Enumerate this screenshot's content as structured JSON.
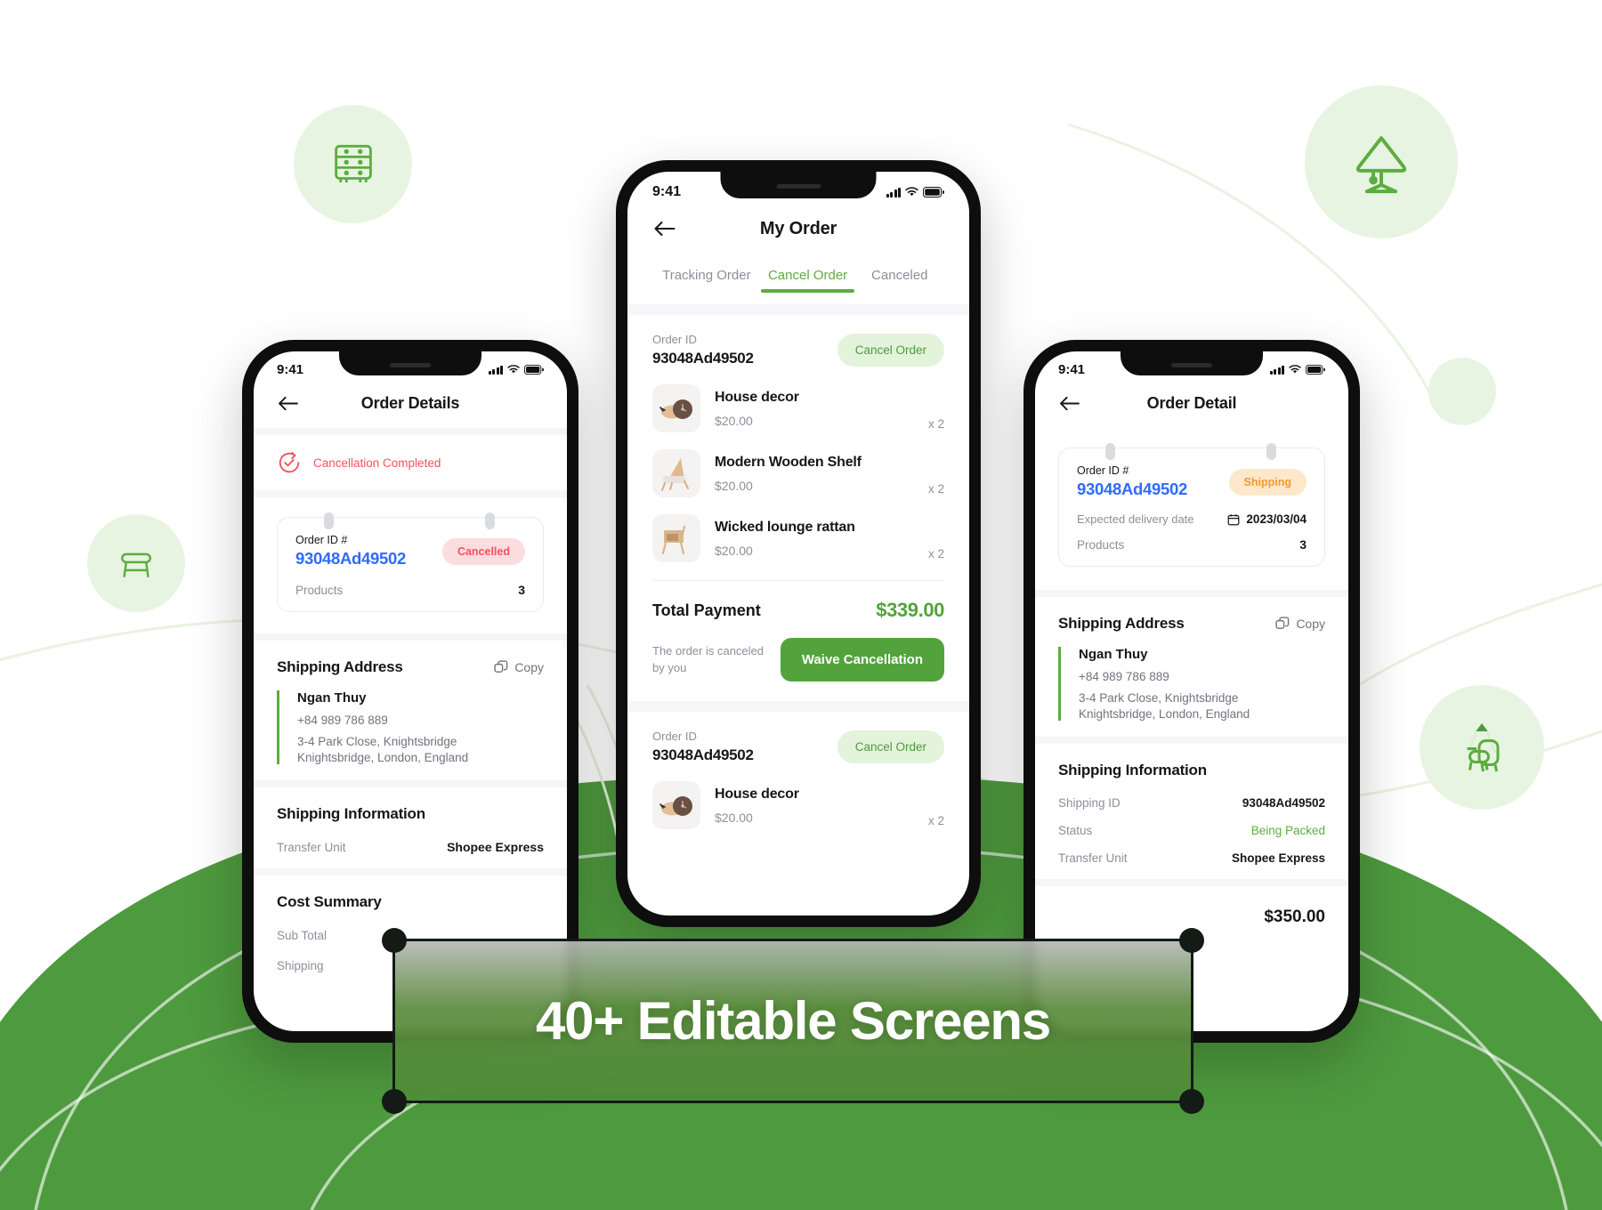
{
  "canvas": {
    "banner_text": "40+ Editable Screens",
    "accent_green": "#5CAD3F",
    "hill_green": "#4E9A3E",
    "blue": "#2F6BFF",
    "red": "#F4525C",
    "orange": "#F59A2B"
  },
  "decor": [
    {
      "name": "dresser-icon",
      "label": "dresser"
    },
    {
      "name": "table-lamp-icon",
      "label": "table lamp"
    },
    {
      "name": "stool-icon",
      "label": "stool"
    },
    {
      "name": "armchair-lamp-icon",
      "label": "armchair with pendant lamp"
    }
  ],
  "phone_left": {
    "status": {
      "time": "9:41",
      "signal": "signal-icon",
      "wifi": "wifi-icon",
      "battery": "battery-icon"
    },
    "nav": {
      "back": "back-arrow-icon",
      "title": "Order Details"
    },
    "alert": {
      "icon": "check-circle-icon",
      "text": "Cancellation Completed"
    },
    "order_card": {
      "id_label": "Order ID #",
      "id_value": "93048Ad49502",
      "badge": "Cancelled",
      "rows": [
        {
          "label": "Products",
          "value": "3"
        }
      ]
    },
    "shipping_address": {
      "title": "Shipping Address",
      "copy_label": "Copy",
      "copy_icon": "copy-icon",
      "name": "Ngan Thuy",
      "phone": "+84 989 786 889",
      "line1": "3-4 Park Close, Knightsbridge",
      "line2": "Knightsbridge, London, England"
    },
    "shipping_information": {
      "title": "Shipping Information",
      "rows": [
        {
          "label": "Transfer Unit",
          "value": "Shopee Express"
        }
      ]
    },
    "cost_summary": {
      "title": "Cost Summary",
      "rows": [
        {
          "label": "Sub Total"
        },
        {
          "label": "Shipping"
        }
      ]
    }
  },
  "phone_center": {
    "status": {
      "time": "9:41",
      "signal": "signal-icon",
      "wifi": "wifi-icon",
      "battery": "battery-icon"
    },
    "nav": {
      "back": "back-arrow-icon",
      "title": "My Order"
    },
    "tabs": [
      {
        "label": "Tracking Order",
        "active": false
      },
      {
        "label": "Cancel Order",
        "active": true
      },
      {
        "label": "Canceled",
        "active": false
      }
    ],
    "order_1": {
      "id_label": "Order ID",
      "id_value": "93048Ad49502",
      "action_label": "Cancel Order",
      "products": [
        {
          "name": "House decor",
          "price": "$20.00",
          "qty": "x 2",
          "thumb": "house-decor-thumb"
        },
        {
          "name": "Modern Wooden Shelf",
          "price": "$20.00",
          "qty": "x 2",
          "thumb": "wooden-shelf-thumb"
        },
        {
          "name": "Wicked lounge rattan",
          "price": "$20.00",
          "qty": "x 2",
          "thumb": "rattan-thumb"
        }
      ],
      "total_label": "Total Payment",
      "total_value": "$339.00",
      "note": "The order is canceled by you",
      "cta": "Waive Cancellation"
    },
    "order_2": {
      "id_label": "Order ID",
      "id_value": "93048Ad49502",
      "action_label": "Cancel Order",
      "products": [
        {
          "name": "House decor",
          "price": "$20.00",
          "qty": "x 2",
          "thumb": "house-decor-thumb"
        }
      ]
    }
  },
  "phone_right": {
    "status": {
      "time": "9:41",
      "signal": "signal-icon",
      "wifi": "wifi-icon",
      "battery": "battery-icon"
    },
    "nav": {
      "back": "back-arrow-icon",
      "title": "Order Detail"
    },
    "order_card": {
      "id_label": "Order ID #",
      "id_value": "93048Ad49502",
      "badge": "Shipping",
      "delivery_label": "Expected delivery date",
      "delivery_icon": "calendar-icon",
      "delivery_value": "2023/03/04",
      "products_label": "Products",
      "products_value": "3"
    },
    "shipping_address": {
      "title": "Shipping Address",
      "copy_label": "Copy",
      "copy_icon": "copy-icon",
      "name": "Ngan Thuy",
      "phone": "+84 989 786 889",
      "line1": "3-4 Park Close, Knightsbridge",
      "line2": "Knightsbridge, London, England"
    },
    "shipping_information": {
      "title": "Shipping Information",
      "rows": [
        {
          "label": "Shipping ID",
          "value": "93048Ad49502",
          "color": "dark"
        },
        {
          "label": "Status",
          "value": "Being Packed",
          "color": "green"
        },
        {
          "label": "Transfer Unit",
          "value": "Shopee Express",
          "color": "dark"
        }
      ]
    },
    "footer_total": "$350.00"
  }
}
